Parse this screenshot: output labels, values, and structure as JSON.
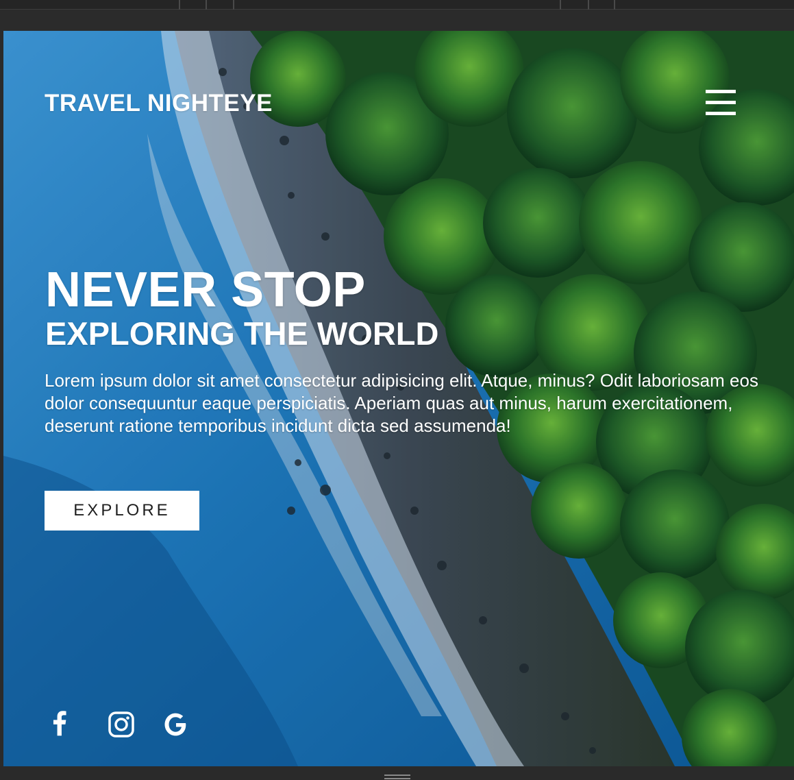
{
  "header": {
    "brand": "TRAVEL NIGHTEYE",
    "menu_icon": "hamburger-menu-icon"
  },
  "hero": {
    "headline": "NEVER STOP",
    "subheadline": "EXPLORING THE WORLD",
    "description": "Lorem ipsum dolor sit amet consectetur adipisicing elit. Atque, minus? Odit laboriosam eos dolor consequuntur eaque perspiciatis. Aperiam quas aut minus, harum exercitationem, deserunt ratione temporibus incidunt dicta sed assumenda!",
    "cta_label": "EXPLORE",
    "background": "aerial view of ocean shoreline and forest"
  },
  "social": [
    {
      "name": "Facebook",
      "icon": "facebook-icon"
    },
    {
      "name": "Instagram",
      "icon": "instagram-icon"
    },
    {
      "name": "Google",
      "icon": "google-icon"
    }
  ],
  "colors": {
    "text": "#ffffff",
    "button_bg": "#ffffff",
    "button_text": "#1f1f1f",
    "chrome": "#2b2b2b"
  }
}
